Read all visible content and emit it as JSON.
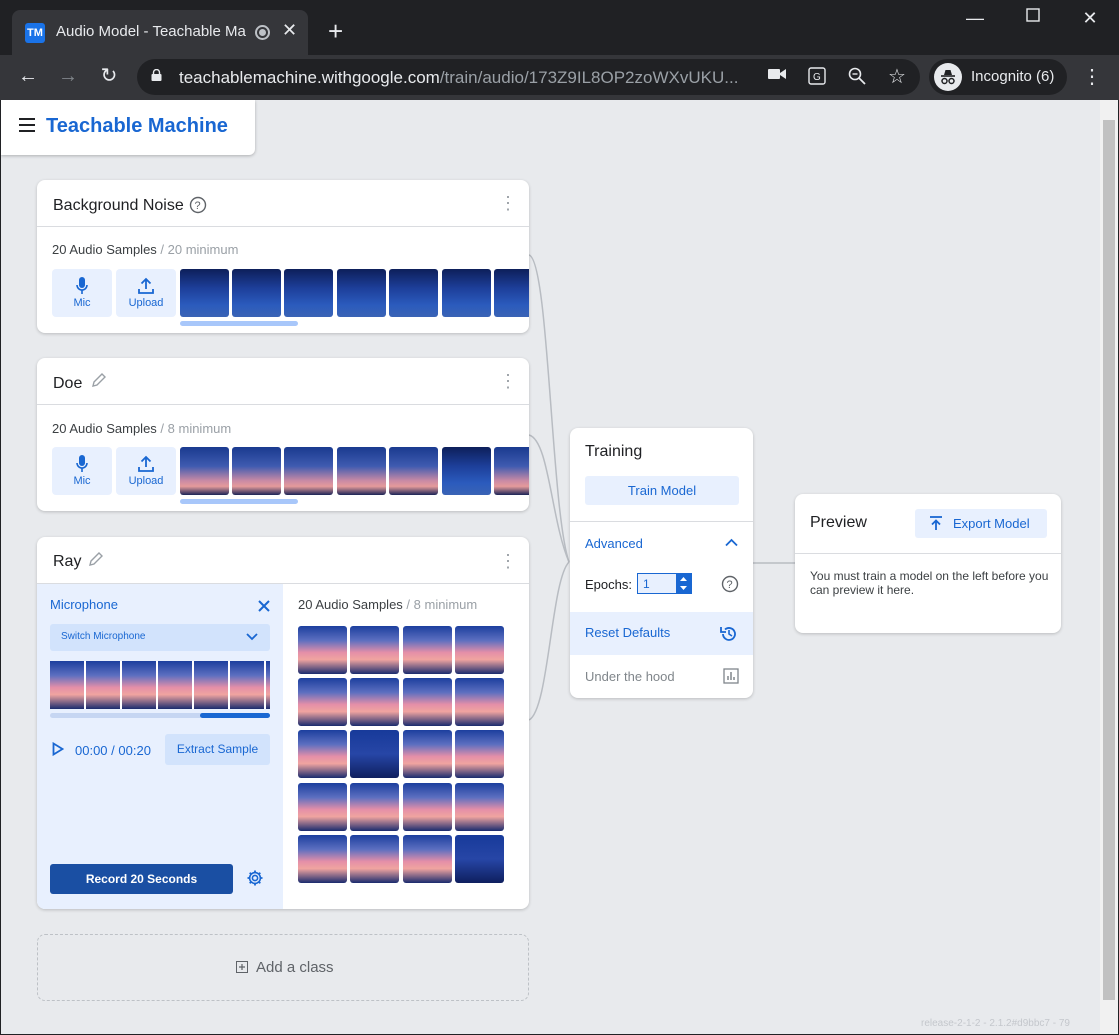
{
  "browser": {
    "tab_title": "Audio Model - Teachable Ma",
    "tab_icon_text": "TM",
    "url_host": "teachablemachine.withgoogle.com",
    "url_path": "/train/audio/173Z9IL8OP2zoWXvUKU...",
    "profile_label": "Incognito (6)"
  },
  "app": {
    "title": "Teachable Machine"
  },
  "classes": [
    {
      "name": "Background Noise",
      "samples": "20 Audio Samples",
      "minimum": "/ 20 minimum",
      "mic_label": "Mic",
      "upload_label": "Upload"
    },
    {
      "name": "Doe",
      "samples": "20 Audio Samples",
      "minimum": "/ 8 minimum",
      "mic_label": "Mic",
      "upload_label": "Upload"
    },
    {
      "name": "Ray",
      "samples": "20 Audio Samples",
      "minimum": "/ 8 minimum"
    }
  ],
  "recorder": {
    "title": "Microphone",
    "switch_label": "Switch Microphone",
    "time_current": "00:00",
    "time_sep": "/",
    "time_total": "00:20",
    "extract_label": "Extract Sample",
    "record_label": "Record 20 Seconds",
    "progress": 0.32
  },
  "add_class": "Add a class",
  "training": {
    "title": "Training",
    "train_button": "Train Model",
    "advanced": "Advanced",
    "epochs_label": "Epochs:",
    "epochs_value": "1",
    "reset_defaults": "Reset Defaults",
    "under_the_hood": "Under the hood"
  },
  "preview": {
    "title": "Preview",
    "export_button": "Export Model",
    "message": "You must train a model on the left before you can preview it here."
  },
  "footer": {
    "version": "release-2-1-2 - 2.1.2#d9bbc7 - 79"
  },
  "colors": {
    "accent": "#1967d2",
    "record_button": "#1a4fa3",
    "page_bg": "#e8eaed"
  }
}
